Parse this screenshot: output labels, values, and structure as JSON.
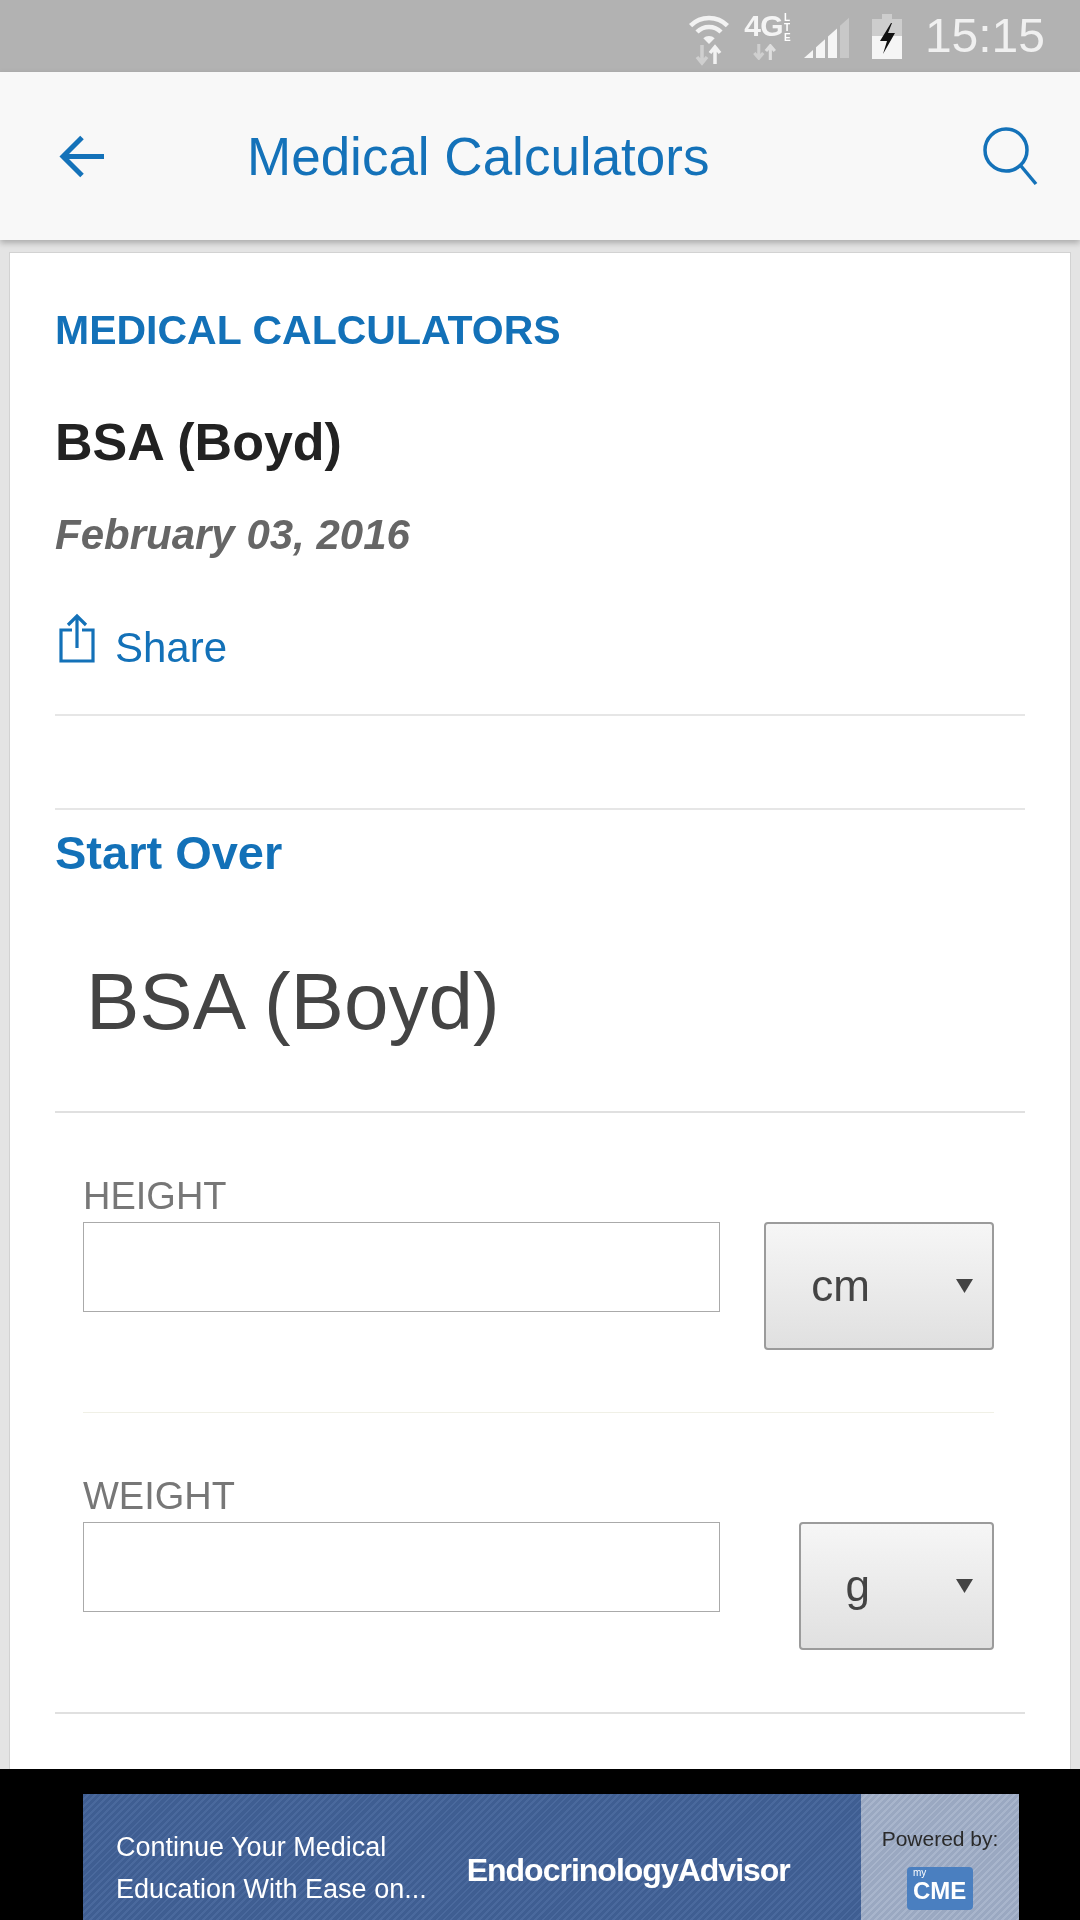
{
  "status_bar": {
    "network": "4G",
    "network_detail": "LTE",
    "time": "15:15"
  },
  "app_bar": {
    "title": "Medical Calculators"
  },
  "article": {
    "category": "MEDICAL CALCULATORS",
    "title": "BSA (Boyd)",
    "date": "February 03, 2016",
    "share": "Share"
  },
  "calculator": {
    "start_over": "Start Over",
    "title": "BSA (Boyd)",
    "fields": [
      {
        "label": "HEIGHT",
        "unit": "cm"
      },
      {
        "label": "WEIGHT",
        "unit": "g"
      }
    ]
  },
  "ad_banner": {
    "tagline": [
      "Continue Your Medical",
      "Education With Ease on..."
    ],
    "brand": "EndocrinologyAdvisor",
    "powered_by": "Powered by:",
    "logo_prefix": "my",
    "logo": "CME"
  }
}
